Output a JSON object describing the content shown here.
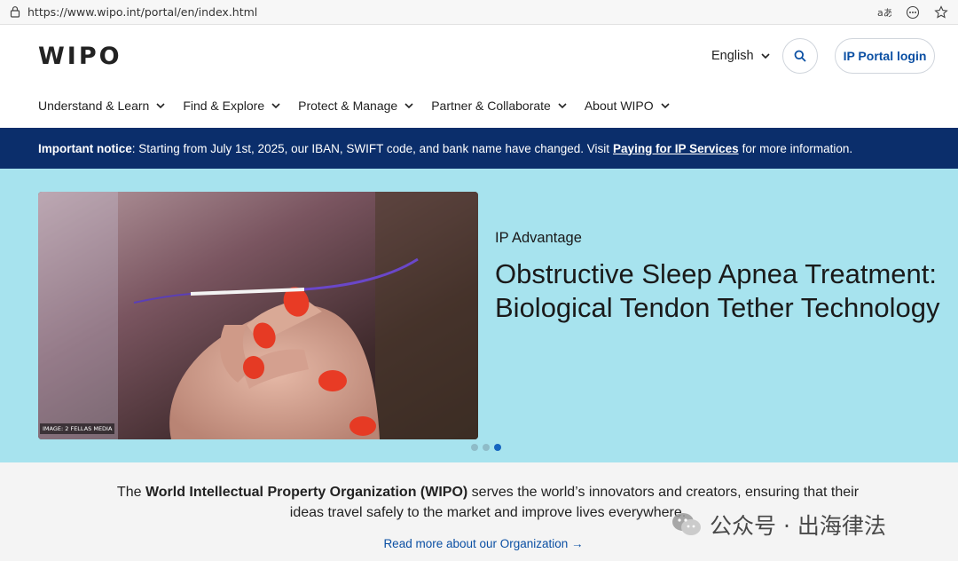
{
  "browser": {
    "url": "https://www.wipo.int/portal/en/index.html",
    "icons": [
      "lock-icon",
      "read-aloud-icon",
      "more-icon",
      "favorite-star-icon"
    ]
  },
  "header": {
    "logo": "WIPO",
    "language": "English",
    "portal_login": "IP Portal login"
  },
  "nav": [
    {
      "label": "Understand & Learn"
    },
    {
      "label": "Find & Explore"
    },
    {
      "label": "Protect & Manage"
    },
    {
      "label": "Partner & Collaborate"
    },
    {
      "label": "About WIPO"
    }
  ],
  "notice": {
    "lead": "Important notice",
    "text": ": Starting from July 1st, 2025, our IBAN, SWIFT code, and bank name have changed. Visit",
    "link": "Paying for IP Services",
    "tail": "for more information."
  },
  "hero": {
    "image_credit": "IMAGE: 2 FELLAS MEDIA",
    "kicker": "IP Advantage",
    "title": "Obstructive Sleep Apnea Treatment: Biological Tendon Tether Technology",
    "slides_total": 3,
    "active_slide": 3
  },
  "about": {
    "pre": "The ",
    "org": "World Intellectual Property Organization (WIPO)",
    "post": " serves the world’s innovators and creators, ensuring that their ideas travel safely to the market and improve lives everywhere.",
    "link": "Read more about our Organization →"
  },
  "watermark": {
    "text": "公众号 · 出海律法"
  },
  "colors": {
    "notice_bg": "#0b2e6b",
    "hero_bg": "#a7e3ee",
    "link": "#0a4fa3"
  }
}
